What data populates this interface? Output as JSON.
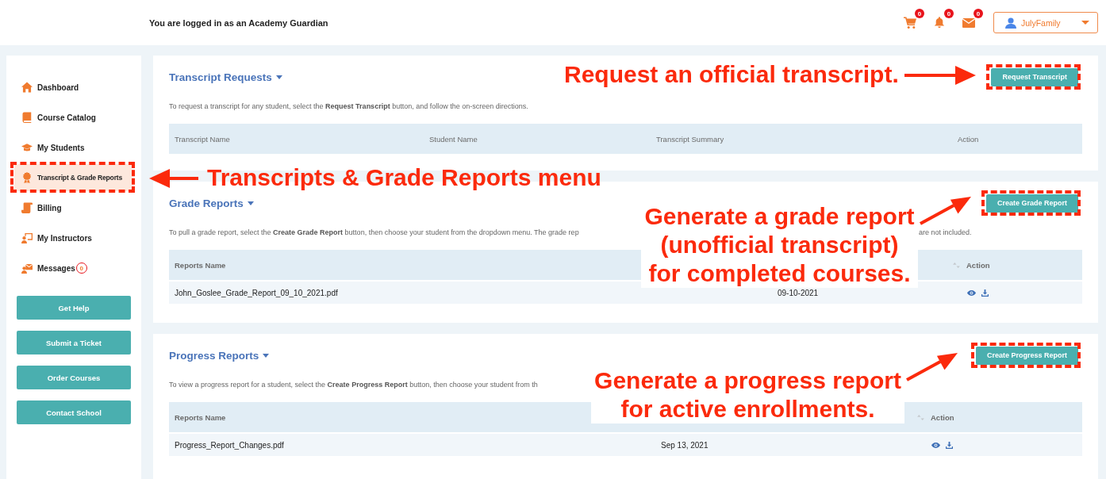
{
  "header": {
    "login_text": "You are logged in as an Academy Guardian",
    "notifications": [
      {
        "badge": "0"
      },
      {
        "badge": "0"
      },
      {
        "badge": "0"
      }
    ],
    "user_menu": {
      "name": "JulyFamily"
    }
  },
  "sidebar": {
    "items": [
      {
        "label": "Dashboard",
        "selected": false,
        "highlighted": false
      },
      {
        "label": "Course Catalog",
        "selected": false,
        "highlighted": false
      },
      {
        "label": "My Students",
        "selected": false,
        "highlighted": false
      },
      {
        "label": "Transcript & Grade Reports",
        "selected": true,
        "highlighted": true
      },
      {
        "label": "Billing",
        "selected": false,
        "highlighted": false
      },
      {
        "label": "My Instructors",
        "selected": false,
        "highlighted": false
      },
      {
        "label": "Messages",
        "selected": false,
        "highlighted": false,
        "badge": "0"
      }
    ],
    "buttons": [
      "Get Help",
      "Submit a Ticket",
      "Order Courses",
      "Contact School"
    ]
  },
  "sections": [
    {
      "title": "Transcript Requests",
      "button": {
        "label": "Request Transcript",
        "highlighted": true
      },
      "description": [
        "To request a transcript for any student, select the **Request Transcript** button, and follow the on-screen directions."
      ],
      "table": {
        "columns": [
          {
            "label": "Transcript Name"
          },
          {
            "label": "Student Name"
          },
          {
            "label": "Transcript Summary"
          },
          {
            "label": "Action"
          }
        ]
      }
    },
    {
      "title": "Grade Reports",
      "button": {
        "label": "Create Grade Report",
        "highlighted": true
      },
      "description": [
        "To pull a grade report, select the **Create Grade Report** button, then choose your student from the dropdown menu. The grade rep",
        "are not included."
      ],
      "table": {
        "columns": [
          {
            "label": "Reports Name"
          },
          {},
          {
            "label": "Action",
            "sort_icon": true
          }
        ],
        "rows": [
          {
            "cells": [
              "John_Goslee_Grade_Report_09_10_2021.pdf",
              "09-10-2021"
            ]
          }
        ]
      }
    },
    {
      "title": "Progress Reports",
      "button": {
        "label": "Create Progress Report",
        "highlighted": true
      },
      "description": [
        "To view a progress report for a student, select the **Create Progress Report** button, then choose your student from th"
      ],
      "table": {
        "columns": [
          {
            "label": "Reports Name"
          },
          {},
          {
            "label": "Action",
            "sort_icon": true
          }
        ],
        "rows": [
          {
            "cells": [
              "Progress_Report_Changes.pdf",
              "Sep 13, 2021"
            ]
          }
        ]
      }
    }
  ],
  "annotations": [
    {
      "kind": "label",
      "text": "Request an official transcript.",
      "arrow": true
    },
    {
      "kind": "label",
      "text": "Transcripts & Grade Reports menu",
      "arrow": true
    },
    {
      "kind": "panel",
      "text": "Generate a grade report\n(unofficial transcript)\nfor completed courses.",
      "arrow": true
    },
    {
      "kind": "panel",
      "text": "Generate a progress report\nfor active enrollments.",
      "arrow": true
    }
  ]
}
